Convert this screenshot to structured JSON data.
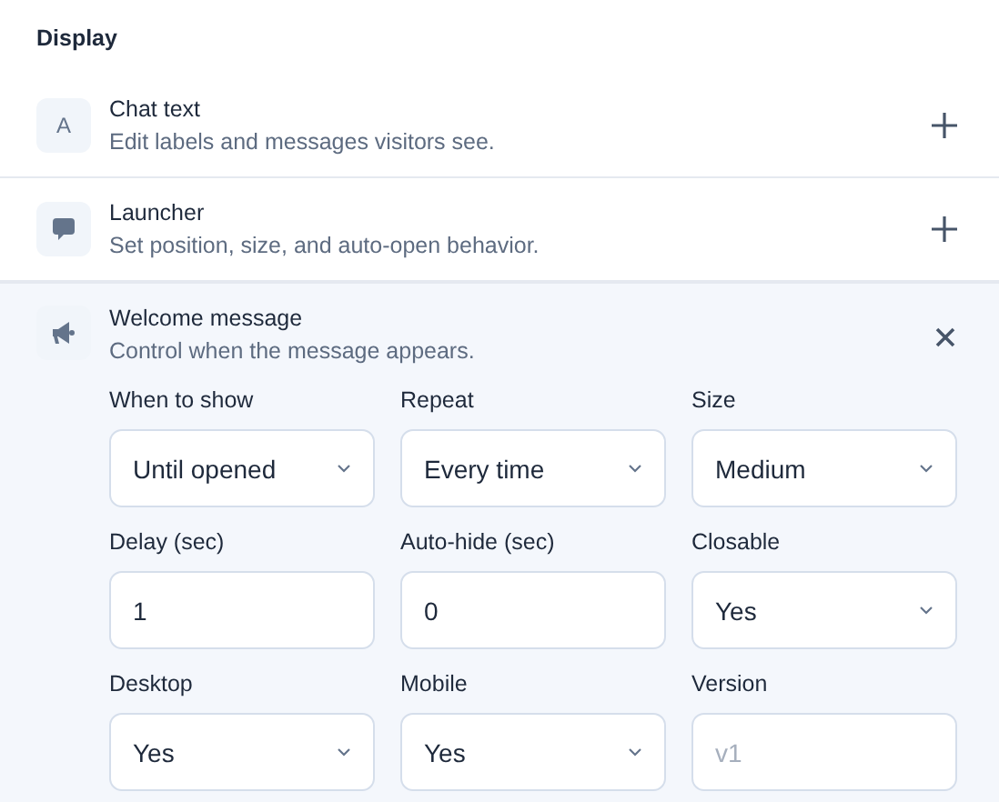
{
  "heading": "Display",
  "sections": [
    {
      "kind": "letter",
      "icon_text": "A",
      "title": "Chat text",
      "subtitle": "Edit labels and messages visitors see.",
      "expanded": false
    },
    {
      "kind": "speech",
      "title": "Launcher",
      "subtitle": "Set position, size, and auto-open behavior.",
      "expanded": false
    },
    {
      "kind": "megaphone",
      "title": "Welcome message",
      "subtitle": "Control when the message appears.",
      "expanded": true,
      "fields": [
        {
          "label": "When to show",
          "kind": "select",
          "value": "Until opened"
        },
        {
          "label": "Repeat",
          "kind": "select",
          "value": "Every time"
        },
        {
          "label": "Size",
          "kind": "select",
          "value": "Medium"
        },
        {
          "label": "Delay (sec)",
          "kind": "input",
          "value": "1"
        },
        {
          "label": "Auto-hide (sec)",
          "kind": "input",
          "value": "0"
        },
        {
          "label": "Closable",
          "kind": "select",
          "value": "Yes"
        },
        {
          "label": "Desktop",
          "kind": "select",
          "value": "Yes"
        },
        {
          "label": "Mobile",
          "kind": "select",
          "value": "Yes"
        },
        {
          "label": "Version",
          "kind": "input",
          "placeholder": "v1"
        }
      ]
    }
  ]
}
